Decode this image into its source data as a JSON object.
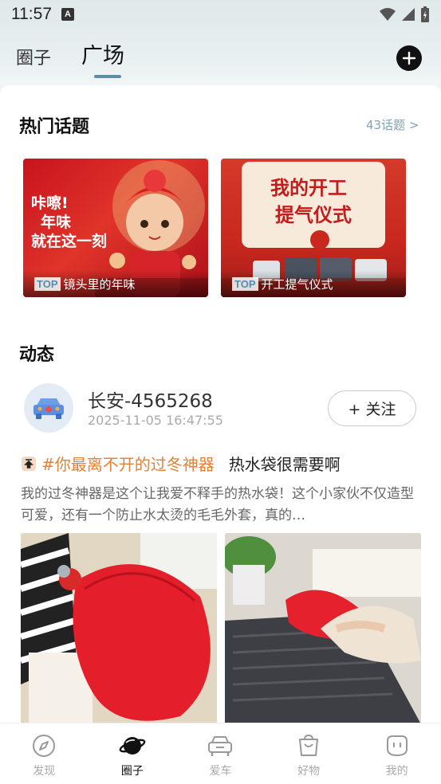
{
  "status_bar": {
    "time": "11:57",
    "notification_icon": "A"
  },
  "header": {
    "tabs": [
      {
        "label": "圈子",
        "active": false
      },
      {
        "label": "广场",
        "active": true
      }
    ],
    "add_icon": "plus-circle-icon"
  },
  "hot_topics": {
    "title": "热门话题",
    "more_label": "43话题 >",
    "cards": [
      {
        "badge": "TOP",
        "label": "镜头里的年味",
        "poster_text": [
          "咔嚓!",
          "年味",
          "就在这一刻"
        ]
      },
      {
        "badge": "TOP",
        "label": "开工提气仪式",
        "poster_text": [
          "我的开工",
          "提气仪式"
        ]
      }
    ]
  },
  "feed": {
    "title": "动态",
    "post": {
      "username": "长安-4565268",
      "time": "2025-11-05 16:47:55",
      "follow_label": "+ 关注",
      "hashtag": "#你最离不开的过冬神器",
      "title": "热水袋很需要啊",
      "body": "我的过冬神器是这个让我爱不释手的热水袋！这个小家伙不仅造型可爱，还有一个防止水太烫的毛毛外套，真的…"
    }
  },
  "bottom_nav": [
    {
      "label": "发现",
      "icon": "compass-icon",
      "active": false
    },
    {
      "label": "圈子",
      "icon": "planet-icon",
      "active": true
    },
    {
      "label": "爱车",
      "icon": "car-icon",
      "active": false
    },
    {
      "label": "好物",
      "icon": "shopping-bag-icon",
      "active": false
    },
    {
      "label": "我的",
      "icon": "profile-face-icon",
      "active": false
    }
  ],
  "colors": {
    "accent": "#5c8fa6",
    "hashtag": "#e58035",
    "link": "#7ea3b6"
  }
}
